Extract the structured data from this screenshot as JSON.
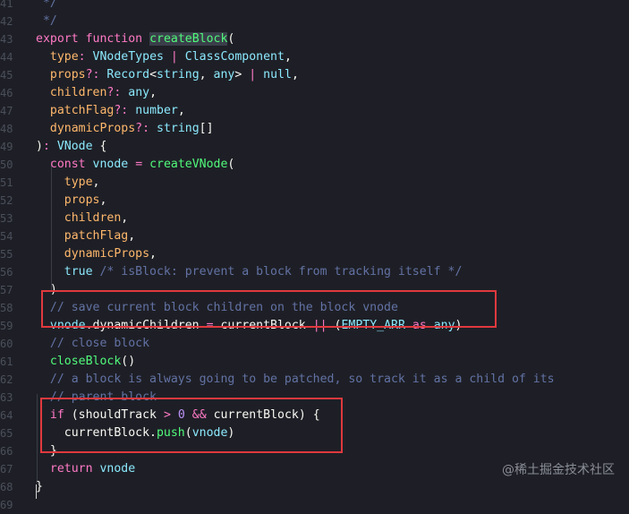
{
  "editor": {
    "lines": [
      {
        "num": "41",
        "tokens": [
          {
            "t": " */",
            "c": "c-co"
          }
        ]
      },
      {
        "num": "42",
        "tokens": [
          {
            "t": " */",
            "c": "c-co"
          }
        ]
      },
      {
        "num": "43",
        "tokens": [
          {
            "t": "export",
            "c": "c-kw"
          },
          {
            "t": " ",
            "c": "c-pl"
          },
          {
            "t": "function",
            "c": "c-kw"
          },
          {
            "t": " ",
            "c": "c-pl"
          },
          {
            "t": "createBlock",
            "c": "c-fn"
          },
          {
            "t": "(",
            "c": "c-pl"
          }
        ]
      },
      {
        "num": "44",
        "tokens": [
          {
            "t": "  ",
            "c": "c-pl"
          },
          {
            "t": "type",
            "c": "c-pa"
          },
          {
            "t": ": ",
            "c": "c-kw"
          },
          {
            "t": "VNodeTypes",
            "c": "c-ty"
          },
          {
            "t": " | ",
            "c": "c-kw"
          },
          {
            "t": "ClassComponent",
            "c": "c-ty"
          },
          {
            "t": ",",
            "c": "c-pl"
          }
        ]
      },
      {
        "num": "45",
        "tokens": [
          {
            "t": "  ",
            "c": "c-pl"
          },
          {
            "t": "props",
            "c": "c-pa"
          },
          {
            "t": "?: ",
            "c": "c-kw"
          },
          {
            "t": "Record",
            "c": "c-ty"
          },
          {
            "t": "<",
            "c": "c-pl"
          },
          {
            "t": "string",
            "c": "c-ty"
          },
          {
            "t": ", ",
            "c": "c-pl"
          },
          {
            "t": "any",
            "c": "c-ty"
          },
          {
            "t": "> ",
            "c": "c-pl"
          },
          {
            "t": "|",
            "c": "c-kw"
          },
          {
            "t": " ",
            "c": "c-pl"
          },
          {
            "t": "null",
            "c": "c-ty"
          },
          {
            "t": ",",
            "c": "c-pl"
          }
        ]
      },
      {
        "num": "46",
        "tokens": [
          {
            "t": "  ",
            "c": "c-pl"
          },
          {
            "t": "children",
            "c": "c-pa"
          },
          {
            "t": "?: ",
            "c": "c-kw"
          },
          {
            "t": "any",
            "c": "c-ty"
          },
          {
            "t": ",",
            "c": "c-pl"
          }
        ]
      },
      {
        "num": "47",
        "tokens": [
          {
            "t": "  ",
            "c": "c-pl"
          },
          {
            "t": "patchFlag",
            "c": "c-pa"
          },
          {
            "t": "?: ",
            "c": "c-kw"
          },
          {
            "t": "number",
            "c": "c-ty"
          },
          {
            "t": ",",
            "c": "c-pl"
          }
        ]
      },
      {
        "num": "48",
        "tokens": [
          {
            "t": "  ",
            "c": "c-pl"
          },
          {
            "t": "dynamicProps",
            "c": "c-pa"
          },
          {
            "t": "?: ",
            "c": "c-kw"
          },
          {
            "t": "string",
            "c": "c-ty"
          },
          {
            "t": "[]",
            "c": "c-pl"
          }
        ]
      },
      {
        "num": "49",
        "tokens": [
          {
            "t": ")",
            "c": "c-pl"
          },
          {
            "t": ": ",
            "c": "c-kw"
          },
          {
            "t": "VNode",
            "c": "c-ty"
          },
          {
            "t": " {",
            "c": "c-pl"
          }
        ]
      },
      {
        "num": "50",
        "tokens": [
          {
            "t": "  ",
            "c": "c-pl"
          },
          {
            "t": "const",
            "c": "c-kw"
          },
          {
            "t": " ",
            "c": "c-pl"
          },
          {
            "t": "vnode",
            "c": "c-ty"
          },
          {
            "t": " = ",
            "c": "c-kw"
          },
          {
            "t": "createVNode",
            "c": "c-fn"
          },
          {
            "t": "(",
            "c": "c-pl"
          }
        ]
      },
      {
        "num": "51",
        "tokens": [
          {
            "t": "    ",
            "c": "c-pl"
          },
          {
            "t": "type",
            "c": "c-pa"
          },
          {
            "t": ",",
            "c": "c-pl"
          }
        ]
      },
      {
        "num": "52",
        "tokens": [
          {
            "t": "    ",
            "c": "c-pl"
          },
          {
            "t": "props",
            "c": "c-pa"
          },
          {
            "t": ",",
            "c": "c-pl"
          }
        ]
      },
      {
        "num": "53",
        "tokens": [
          {
            "t": "    ",
            "c": "c-pl"
          },
          {
            "t": "children",
            "c": "c-pa"
          },
          {
            "t": ",",
            "c": "c-pl"
          }
        ]
      },
      {
        "num": "54",
        "tokens": [
          {
            "t": "    ",
            "c": "c-pl"
          },
          {
            "t": "patchFlag",
            "c": "c-pa"
          },
          {
            "t": ",",
            "c": "c-pl"
          }
        ]
      },
      {
        "num": "55",
        "tokens": [
          {
            "t": "    ",
            "c": "c-pl"
          },
          {
            "t": "dynamicProps",
            "c": "c-pa"
          },
          {
            "t": ",",
            "c": "c-pl"
          }
        ]
      },
      {
        "num": "56",
        "tokens": [
          {
            "t": "    ",
            "c": "c-pl"
          },
          {
            "t": "true",
            "c": "c-ty"
          },
          {
            "t": " /* isBlock: prevent a block from tracking itself */",
            "c": "c-co"
          }
        ]
      },
      {
        "num": "57",
        "tokens": [
          {
            "t": "  )",
            "c": "c-pl"
          }
        ]
      },
      {
        "num": "58",
        "tokens": [
          {
            "t": "  ",
            "c": "c-pl"
          },
          {
            "t": "// save current block children on the block vnode",
            "c": "c-co"
          }
        ]
      },
      {
        "num": "59",
        "tokens": [
          {
            "t": "  ",
            "c": "c-pl"
          },
          {
            "t": "vnode",
            "c": "c-ty"
          },
          {
            "t": ".dynamicChildren ",
            "c": "c-pl"
          },
          {
            "t": "=",
            "c": "c-kw"
          },
          {
            "t": " currentBlock ",
            "c": "c-pl"
          },
          {
            "t": "||",
            "c": "c-kw"
          },
          {
            "t": " (",
            "c": "c-pl"
          },
          {
            "t": "EMPTY_ARR",
            "c": "c-ty"
          },
          {
            "t": " as ",
            "c": "c-kw"
          },
          {
            "t": "any",
            "c": "c-ty"
          },
          {
            "t": ")",
            "c": "c-pl"
          }
        ]
      },
      {
        "num": "60",
        "tokens": [
          {
            "t": "  ",
            "c": "c-pl"
          },
          {
            "t": "// close block",
            "c": "c-co"
          }
        ]
      },
      {
        "num": "61",
        "tokens": [
          {
            "t": "  ",
            "c": "c-pl"
          },
          {
            "t": "closeBlock",
            "c": "c-fn"
          },
          {
            "t": "()",
            "c": "c-pl"
          }
        ]
      },
      {
        "num": "62",
        "tokens": [
          {
            "t": "  ",
            "c": "c-pl"
          },
          {
            "t": "// a block is always going to be patched, so track it as a child of its",
            "c": "c-co"
          }
        ]
      },
      {
        "num": "63",
        "tokens": [
          {
            "t": "  ",
            "c": "c-pl"
          },
          {
            "t": "// parent block",
            "c": "c-co"
          }
        ]
      },
      {
        "num": "64",
        "tokens": [
          {
            "t": "  ",
            "c": "c-pl"
          },
          {
            "t": "if",
            "c": "c-kw"
          },
          {
            "t": " (shouldTrack ",
            "c": "c-pl"
          },
          {
            "t": ">",
            "c": "c-kw"
          },
          {
            "t": " ",
            "c": "c-pl"
          },
          {
            "t": "0",
            "c": "c-nu"
          },
          {
            "t": " ",
            "c": "c-pl"
          },
          {
            "t": "&&",
            "c": "c-kw"
          },
          {
            "t": " currentBlock) {",
            "c": "c-pl"
          }
        ]
      },
      {
        "num": "65",
        "tokens": [
          {
            "t": "    currentBlock.",
            "c": "c-pl"
          },
          {
            "t": "push",
            "c": "c-fn"
          },
          {
            "t": "(",
            "c": "c-pl"
          },
          {
            "t": "vnode",
            "c": "c-ty"
          },
          {
            "t": ")",
            "c": "c-pl"
          }
        ]
      },
      {
        "num": "66",
        "tokens": [
          {
            "t": "  }",
            "c": "c-pl"
          }
        ]
      },
      {
        "num": "67",
        "tokens": [
          {
            "t": "  ",
            "c": "c-pl"
          },
          {
            "t": "return",
            "c": "c-kw"
          },
          {
            "t": " ",
            "c": "c-pl"
          },
          {
            "t": "vnode",
            "c": "c-ty"
          }
        ]
      },
      {
        "num": "68",
        "tokens": [
          {
            "t": "}",
            "c": "c-pl"
          }
        ]
      },
      {
        "num": "69",
        "tokens": []
      }
    ]
  },
  "watermark": "@稀土掘金技术社区",
  "colors": {
    "background": "#1e1f26",
    "highlight_border": "#e0393e"
  }
}
